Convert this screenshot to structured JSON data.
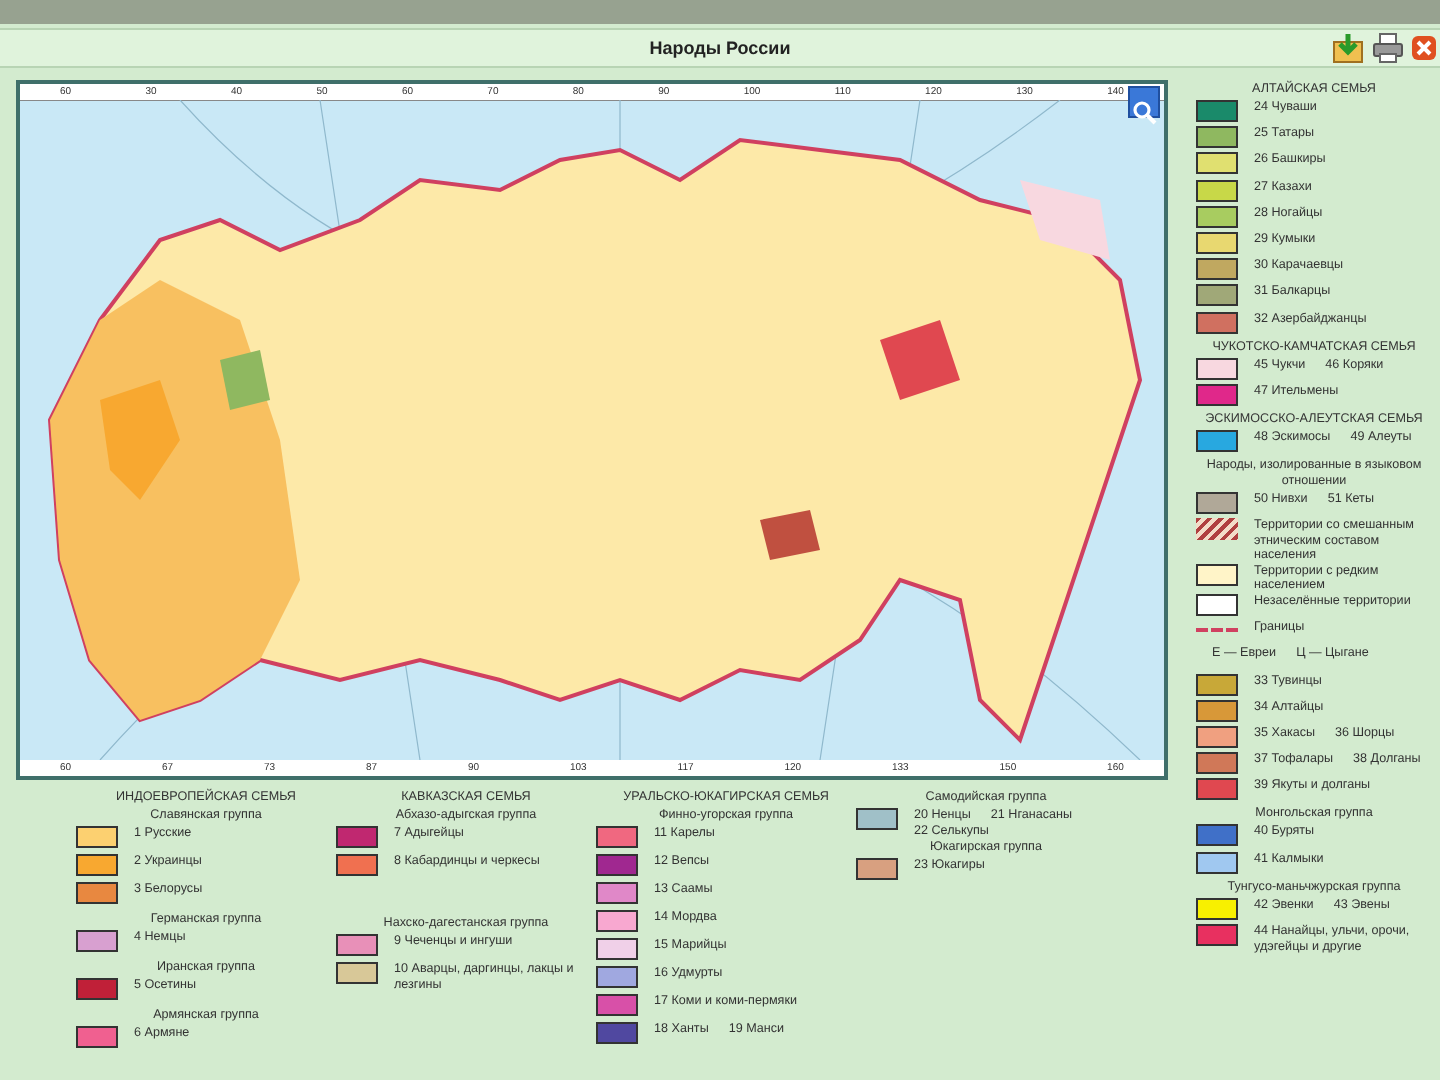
{
  "window": {
    "title": "Народы России"
  },
  "map": {
    "top_ticks": [
      "60",
      "30",
      "40",
      "50",
      "60",
      "70",
      "80",
      "90",
      "100",
      "110",
      "120",
      "130",
      "140"
    ],
    "bottom_ticks": [
      "60",
      "67",
      "73",
      "87",
      "90",
      "103",
      "117",
      "120",
      "133",
      "150",
      "160"
    ]
  },
  "legend_right": [
    {
      "kind": "heading",
      "text": "АЛТАЙСКАЯ СЕМЬЯ"
    },
    {
      "kind": "swatch",
      "color": "#1a8a6a",
      "labels": [
        "24 Чуваши"
      ]
    },
    {
      "kind": "swatch",
      "color": "#8fb860",
      "labels": [
        "25 Татары"
      ]
    },
    {
      "kind": "swatch",
      "color": "#e0e070",
      "labels": [
        "26 Башкиры"
      ]
    },
    {
      "kind": "swatch",
      "color": "#c8d848",
      "labels": [
        "27 Казахи"
      ]
    },
    {
      "kind": "swatch",
      "color": "#a8cc60",
      "labels": [
        "28 Ногайцы"
      ]
    },
    {
      "kind": "swatch",
      "color": "#e8d870",
      "labels": [
        "29 Кумыки"
      ]
    },
    {
      "kind": "swatch",
      "color": "#c0a860",
      "labels": [
        "30 Карачаевцы"
      ]
    },
    {
      "kind": "swatch",
      "color": "#a0a878",
      "labels": [
        "31 Балкарцы"
      ]
    },
    {
      "kind": "swatch",
      "color": "#d07060",
      "labels": [
        "32 Азербайджанцы"
      ]
    },
    {
      "kind": "heading",
      "text": "ЧУКОТСКО-КАМЧАТСКАЯ СЕМЬЯ"
    },
    {
      "kind": "swatch",
      "color": "#f8d8e0",
      "labels": [
        "45 Чукчи",
        "46 Коряки"
      ]
    },
    {
      "kind": "swatch",
      "color": "#e0288a",
      "labels": [
        "47 Ительмены"
      ]
    },
    {
      "kind": "heading",
      "text": "ЭСКИМОССКО-АЛЕУТСКАЯ СЕМЬЯ"
    },
    {
      "kind": "swatch",
      "color": "#28a8e0",
      "labels": [
        "48 Эскимосы",
        "49 Алеуты"
      ]
    },
    {
      "kind": "heading",
      "text": "Народы, изолированные в языковом отношении"
    },
    {
      "kind": "swatch",
      "color": "#b0a898",
      "labels": [
        "50 Нивхи",
        "51 Кеты"
      ]
    },
    {
      "kind": "hatch",
      "labels": [
        "Территории со смешанным этническим составом населения"
      ]
    },
    {
      "kind": "swatch",
      "color": "#fff4c8",
      "labels": [
        "Территории с редким населением"
      ]
    },
    {
      "kind": "swatch",
      "color": "#ffffff",
      "labels": [
        "Незаселённые территории"
      ]
    },
    {
      "kind": "line",
      "labels": [
        "Границы"
      ]
    },
    {
      "kind": "text",
      "labels": [
        "Е — Евреи",
        "Ц — Цыгане"
      ]
    },
    {
      "kind": "swatch",
      "color": "#c8a838",
      "labels": [
        "33 Тувинцы"
      ]
    },
    {
      "kind": "swatch",
      "color": "#d89838",
      "labels": [
        "34 Алтайцы"
      ]
    },
    {
      "kind": "swatch",
      "color": "#f0a080",
      "labels": [
        "35 Хакасы",
        "36 Шорцы"
      ]
    },
    {
      "kind": "swatch",
      "color": "#d07858",
      "labels": [
        "37 Тофалары",
        "38 Долганы"
      ]
    },
    {
      "kind": "swatch",
      "color": "#e04850",
      "labels": [
        "39 Якуты и долганы"
      ]
    },
    {
      "kind": "heading",
      "text": "Монгольская группа"
    },
    {
      "kind": "swatch",
      "color": "#4070c8",
      "labels": [
        "40 Буряты"
      ]
    },
    {
      "kind": "swatch",
      "color": "#a0c8f0",
      "labels": [
        "41 Калмыки"
      ]
    },
    {
      "kind": "heading",
      "text": "Тунгусо-маньчжурская группа"
    },
    {
      "kind": "swatch",
      "color": "#f8f000",
      "labels": [
        "42 Эвенки",
        "43 Эвены"
      ]
    },
    {
      "kind": "swatch",
      "color": "#e83060",
      "labels": [
        "44 Нанайцы, ульчи, орочи, удэгейцы и другие"
      ]
    }
  ],
  "legend_bottom": [
    [
      {
        "kind": "heading",
        "text": "ИНДОЕВРОПЕЙСКАЯ СЕМЬЯ"
      },
      {
        "kind": "heading",
        "text": "Славянская группа"
      },
      {
        "kind": "swatch",
        "color": "#fcd070",
        "labels": [
          "1 Русские"
        ]
      },
      {
        "kind": "swatch",
        "color": "#f8a830",
        "labels": [
          "2 Украинцы"
        ]
      },
      {
        "kind": "swatch",
        "color": "#e88840",
        "labels": [
          "3 Белорусы"
        ]
      },
      {
        "kind": "heading",
        "text": "Германская группа"
      },
      {
        "kind": "swatch",
        "color": "#d8a0d0",
        "labels": [
          "4 Немцы"
        ]
      },
      {
        "kind": "heading",
        "text": "Иранская группа"
      },
      {
        "kind": "swatch",
        "color": "#c02038",
        "labels": [
          "5 Осетины"
        ]
      },
      {
        "kind": "heading",
        "text": "Армянская группа"
      },
      {
        "kind": "swatch",
        "color": "#f06090",
        "labels": [
          "6 Армяне"
        ]
      }
    ],
    [
      {
        "kind": "heading",
        "text": "КАВКАЗСКАЯ СЕМЬЯ"
      },
      {
        "kind": "heading",
        "text": "Абхазо-адыгская группа"
      },
      {
        "kind": "swatch",
        "color": "#c02870",
        "labels": [
          "7 Адыгейцы"
        ]
      },
      {
        "kind": "swatch",
        "color": "#f07050",
        "labels": [
          "8 Кабардинцы и черкесы"
        ]
      },
      {
        "kind": "gap"
      },
      {
        "kind": "heading",
        "text": "Нахско-дагестанская группа"
      },
      {
        "kind": "swatch",
        "color": "#e890b8",
        "labels": [
          "9 Чеченцы и ингуши"
        ]
      },
      {
        "kind": "swatch",
        "color": "#d8c898",
        "labels": [
          "10 Аварцы, даргинцы, лакцы и лезгины"
        ]
      }
    ],
    [
      {
        "kind": "heading",
        "text": "УРАЛЬСКО-ЮКАГИРСКАЯ СЕМЬЯ"
      },
      {
        "kind": "heading",
        "text": "Финно-угорская группа"
      },
      {
        "kind": "swatch",
        "color": "#f06880",
        "labels": [
          "11 Карелы"
        ]
      },
      {
        "kind": "swatch",
        "color": "#a02890",
        "labels": [
          "12 Вепсы"
        ]
      },
      {
        "kind": "swatch",
        "color": "#e088c8",
        "labels": [
          "13 Саамы"
        ]
      },
      {
        "kind": "swatch",
        "color": "#f8a8d0",
        "labels": [
          "14 Мордва"
        ]
      },
      {
        "kind": "swatch",
        "color": "#f0d0e8",
        "labels": [
          "15 Марийцы"
        ]
      },
      {
        "kind": "swatch",
        "color": "#a0a8e0",
        "labels": [
          "16 Удмурты"
        ]
      },
      {
        "kind": "swatch",
        "color": "#d850a8",
        "labels": [
          "17 Коми и коми-пермяки"
        ]
      },
      {
        "kind": "swatch",
        "color": "#5048a0",
        "labels": [
          "18 Ханты",
          "19 Манси"
        ]
      }
    ],
    [
      {
        "kind": "heading",
        "text": "Самодийская группа"
      },
      {
        "kind": "swatch",
        "color": "#a0c0c8",
        "labels": [
          "20 Ненцы",
          "21 Нганасаны",
          "22 Селькупы"
        ]
      },
      {
        "kind": "heading",
        "text": "Юкагирская группа"
      },
      {
        "kind": "swatch",
        "color": "#d8a080",
        "labels": [
          "23 Юкагиры"
        ]
      }
    ]
  ]
}
